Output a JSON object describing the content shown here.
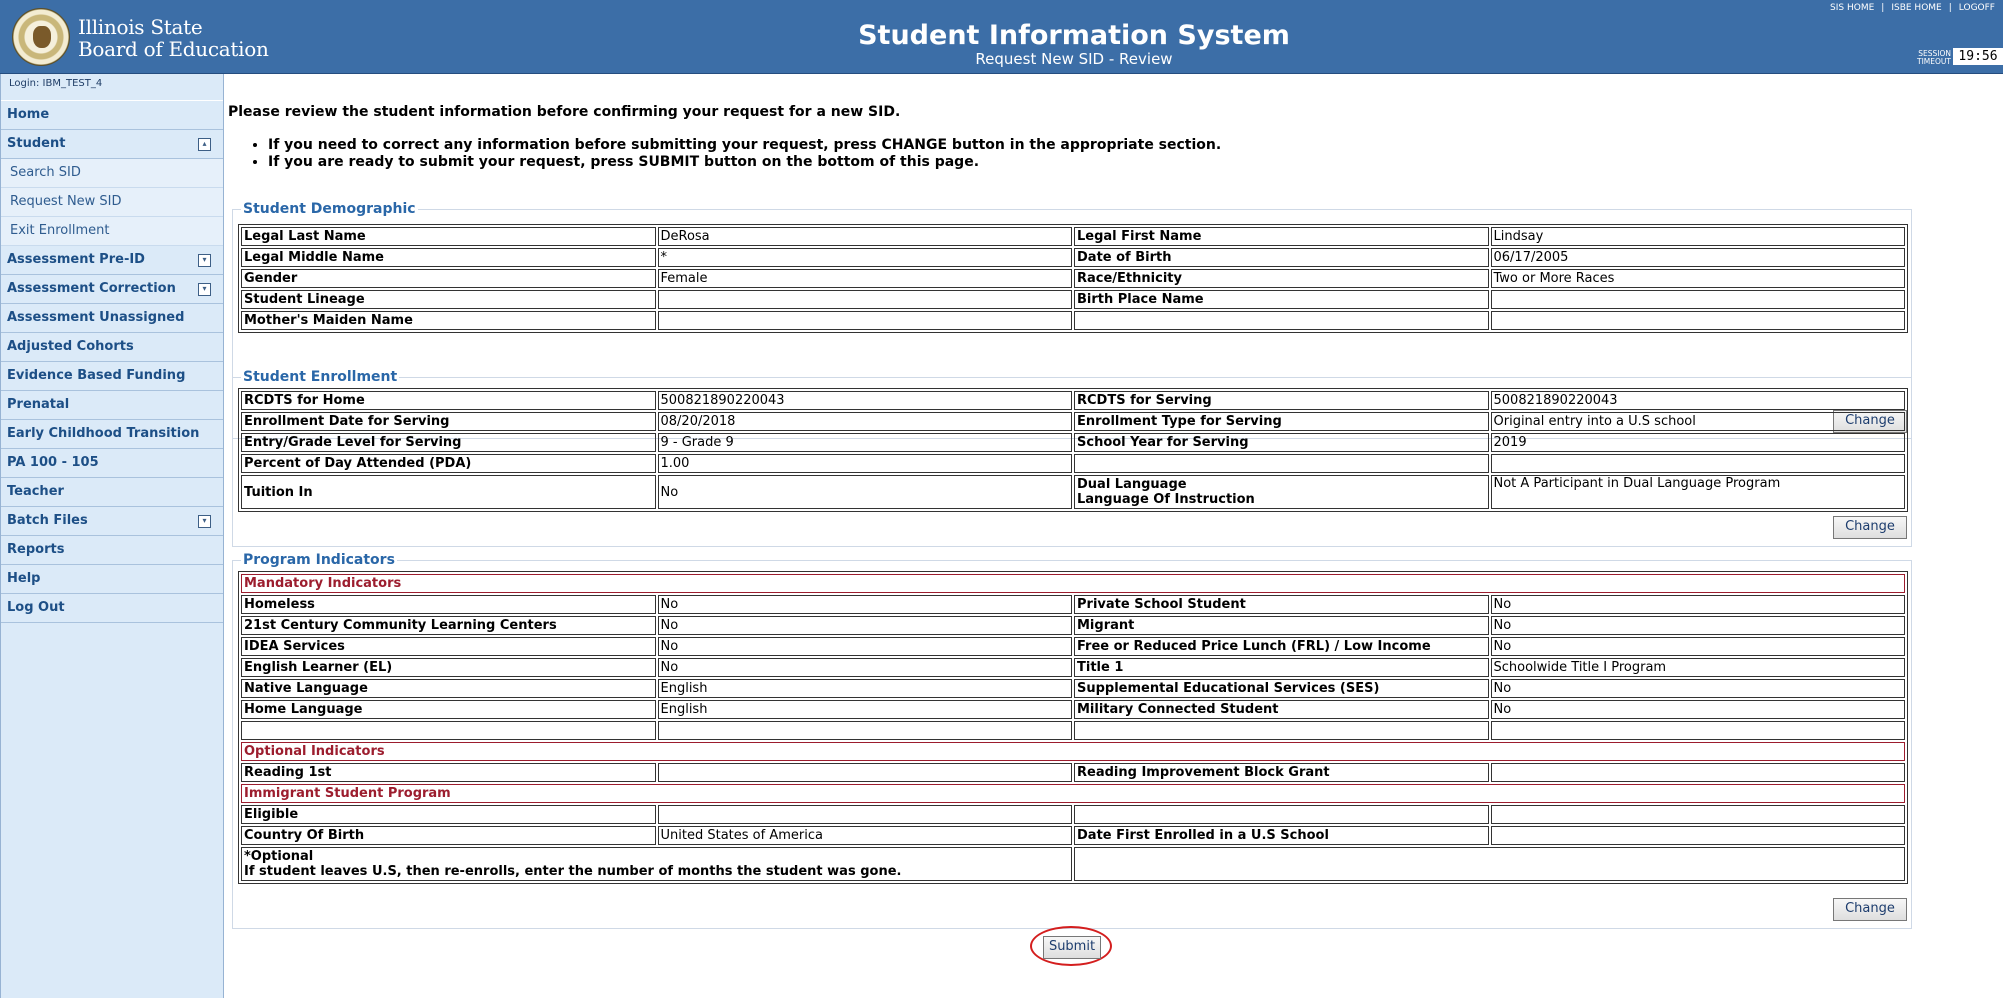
{
  "header": {
    "org_line1": "Illinois State",
    "org_line2": "Board of Education",
    "title": "Student Information System",
    "subtitle": "Request New SID - Review",
    "links": [
      "SIS HOME",
      "ISBE HOME",
      "LOGOFF"
    ],
    "session_label_1": "SESSION",
    "session_label_2": "TIMEOUT",
    "session_time": "19:56"
  },
  "sidebar": {
    "login": "Login: IBM_TEST_4",
    "items": [
      {
        "label": "Home"
      },
      {
        "label": "Student",
        "toggle": "up"
      },
      {
        "label": "Search SID",
        "sub": true
      },
      {
        "label": "Request New SID",
        "sub": true
      },
      {
        "label": "Exit Enrollment",
        "sub": true
      },
      {
        "label": "Assessment Pre-ID",
        "toggle": "down"
      },
      {
        "label": "Assessment Correction",
        "toggle": "down"
      },
      {
        "label": "Assessment Unassigned"
      },
      {
        "label": "Adjusted Cohorts"
      },
      {
        "label": "Evidence Based Funding"
      },
      {
        "label": "Prenatal"
      },
      {
        "label": "Early Childhood Transition"
      },
      {
        "label": "PA 100 - 105"
      },
      {
        "label": "Teacher"
      },
      {
        "label": "Batch Files",
        "toggle": "down"
      },
      {
        "label": "Reports"
      },
      {
        "label": "Help"
      },
      {
        "label": "Log Out"
      }
    ]
  },
  "main": {
    "intro": "Please review the student information before confirming your request for a new SID.",
    "bullets": [
      "If you need to correct any information before submitting your request, press CHANGE button in the appropriate section.",
      "If you are ready to submit your request, press SUBMIT button on the bottom of this page."
    ],
    "change_label": "Change",
    "submit_label": "Submit",
    "demographic": {
      "title": "Student Demographic",
      "rows": [
        [
          "Legal Last Name",
          "DeRosa",
          "Legal First Name",
          "Lindsay"
        ],
        [
          "Legal Middle Name",
          "*",
          "Date of Birth",
          "06/17/2005"
        ],
        [
          "Gender",
          "Female",
          "Race/Ethnicity",
          "Two or More Races"
        ],
        [
          "Student Lineage",
          "",
          "Birth Place Name",
          ""
        ],
        [
          "Mother's Maiden Name",
          "",
          "",
          ""
        ]
      ]
    },
    "enrollment": {
      "title": "Student Enrollment",
      "rows": [
        [
          "RCDTS for Home",
          "500821890220043",
          "RCDTS for Serving",
          "500821890220043"
        ],
        [
          "Enrollment Date for Serving",
          "08/20/2018",
          "Enrollment Type for Serving",
          "Original entry into a U.S school"
        ],
        [
          "Entry/Grade Level for Serving",
          "9 - Grade 9",
          "School Year for Serving",
          "2019"
        ],
        [
          "Percent of Day Attended (PDA)",
          "1.00",
          "",
          ""
        ]
      ],
      "tuition_label": "Tuition In",
      "tuition_value": "No",
      "dual_label_1": "Dual Language",
      "dual_label_2": "Language Of Instruction",
      "dual_value": "Not A Participant in Dual Language Program"
    },
    "program": {
      "title": "Program Indicators",
      "mandatory_title": "Mandatory Indicators",
      "mandatory_rows": [
        [
          "Homeless",
          "No",
          "Private School Student",
          "No"
        ],
        [
          "21st Century Community Learning Centers",
          "No",
          "Migrant",
          "No"
        ],
        [
          "IDEA Services",
          "No",
          "Free or Reduced Price Lunch (FRL) / Low Income",
          "No"
        ],
        [
          "English Learner (EL)",
          "No",
          "Title 1",
          "Schoolwide Title I Program"
        ],
        [
          "Native Language",
          "English",
          "Supplemental Educational Services (SES)",
          "No"
        ],
        [
          "Home Language",
          "English",
          "Military Connected Student",
          "No"
        ],
        [
          "",
          "",
          "",
          ""
        ]
      ],
      "optional_title": "Optional Indicators",
      "optional_rows": [
        [
          "Reading 1st",
          "",
          "Reading Improvement Block Grant",
          ""
        ]
      ],
      "immigrant_title": "Immigrant Student Program",
      "immigrant_rows": [
        [
          "Eligible",
          "",
          "",
          ""
        ],
        [
          "Country Of Birth",
          "United States of America",
          "Date First Enrolled in a U.S School",
          ""
        ]
      ],
      "optional_note_1": "*Optional",
      "optional_note_2": "If student leaves U.S, then re-enrolls, enter the number of months the student was gone."
    }
  }
}
